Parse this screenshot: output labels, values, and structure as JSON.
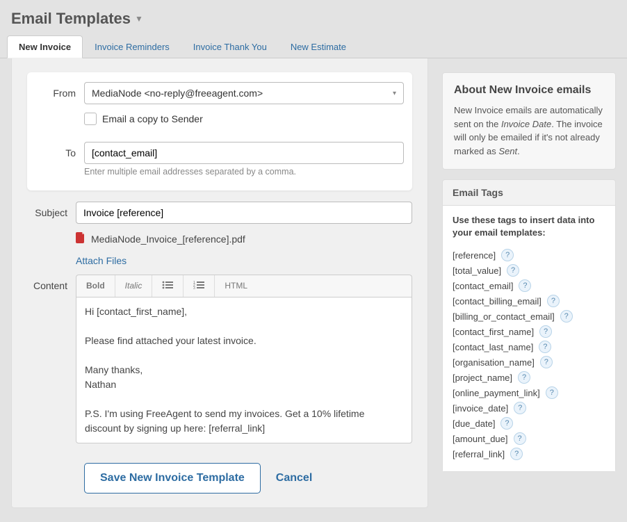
{
  "page": {
    "title": "Email Templates"
  },
  "tabs": [
    {
      "label": "New Invoice",
      "active": true
    },
    {
      "label": "Invoice Reminders",
      "active": false
    },
    {
      "label": "Invoice Thank You",
      "active": false
    },
    {
      "label": "New Estimate",
      "active": false
    }
  ],
  "labels": {
    "from": "From",
    "to": "To",
    "subject": "Subject",
    "content": "Content",
    "email_copy": "Email a copy to Sender",
    "to_hint": "Enter multiple email addresses separated by a comma.",
    "attach_files": "Attach Files",
    "save": "Save New Invoice Template",
    "cancel": "Cancel"
  },
  "form": {
    "from_value": "MediaNode <no-reply@freeagent.com>",
    "to_value": "[contact_email]",
    "subject_value": "Invoice [reference]",
    "attachment_name": "MediaNode_Invoice_[reference].pdf",
    "content_body": "Hi [contact_first_name],\n\nPlease find attached your latest invoice.\n\nMany thanks,\nNathan\n\nP.S. I'm using FreeAgent to send my invoices. Get a 10% lifetime discount by signing up here: [referral_link]"
  },
  "toolbar": {
    "bold": "Bold",
    "italic": "Italic",
    "html": "HTML"
  },
  "about": {
    "title": "About New Invoice emails",
    "body_1": "New Invoice emails are automatically sent on the ",
    "body_em": "Invoice Date",
    "body_2": ". The invoice will only be emailed if it's not already marked as ",
    "body_em2": "Sent",
    "body_3": "."
  },
  "tags_panel": {
    "header": "Email Tags",
    "intro": "Use these tags to insert data into your email templates:",
    "items": [
      "[reference]",
      "[total_value]",
      "[contact_email]",
      "[contact_billing_email]",
      "[billing_or_contact_email]",
      "[contact_first_name]",
      "[contact_last_name]",
      "[organisation_name]",
      "[project_name]",
      "[online_payment_link]",
      "[invoice_date]",
      "[due_date]",
      "[amount_due]",
      "[referral_link]"
    ]
  }
}
